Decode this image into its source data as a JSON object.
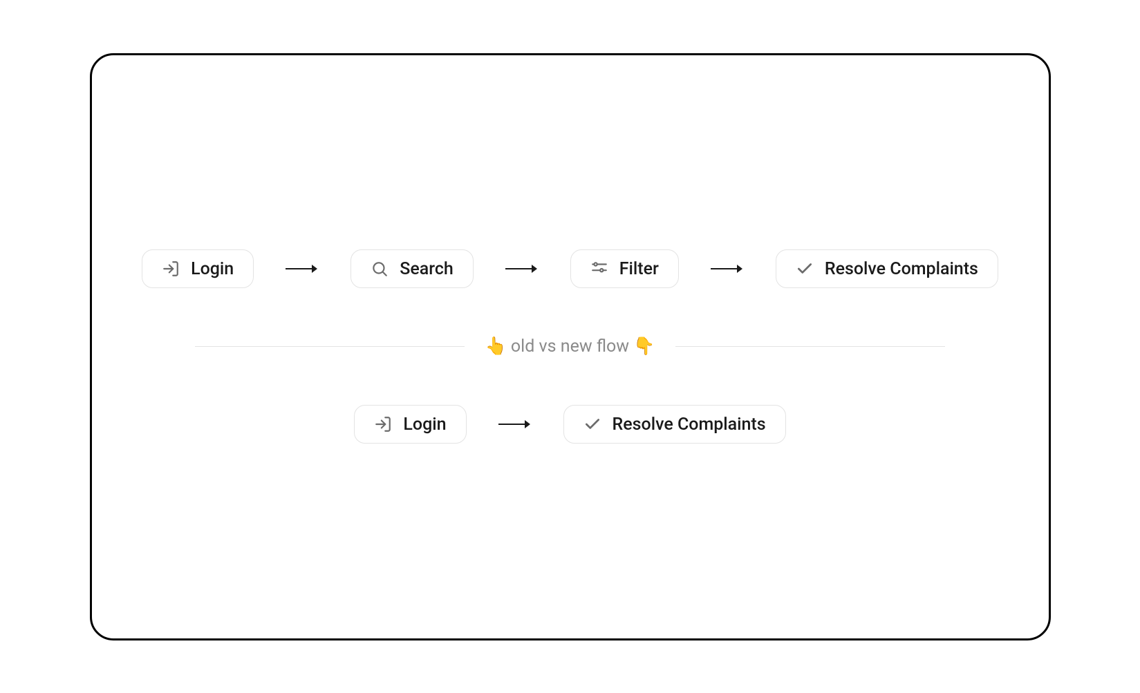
{
  "oldFlow": {
    "steps": [
      {
        "icon": "login-icon",
        "label": "Login"
      },
      {
        "icon": "search-icon",
        "label": "Search"
      },
      {
        "icon": "filter-icon",
        "label": "Filter"
      },
      {
        "icon": "check-icon",
        "label": "Resolve Complaints"
      }
    ]
  },
  "divider": {
    "label": "👆 old vs new flow 👇"
  },
  "newFlow": {
    "steps": [
      {
        "icon": "login-icon",
        "label": "Login"
      },
      {
        "icon": "check-icon",
        "label": "Resolve Complaints"
      }
    ]
  }
}
